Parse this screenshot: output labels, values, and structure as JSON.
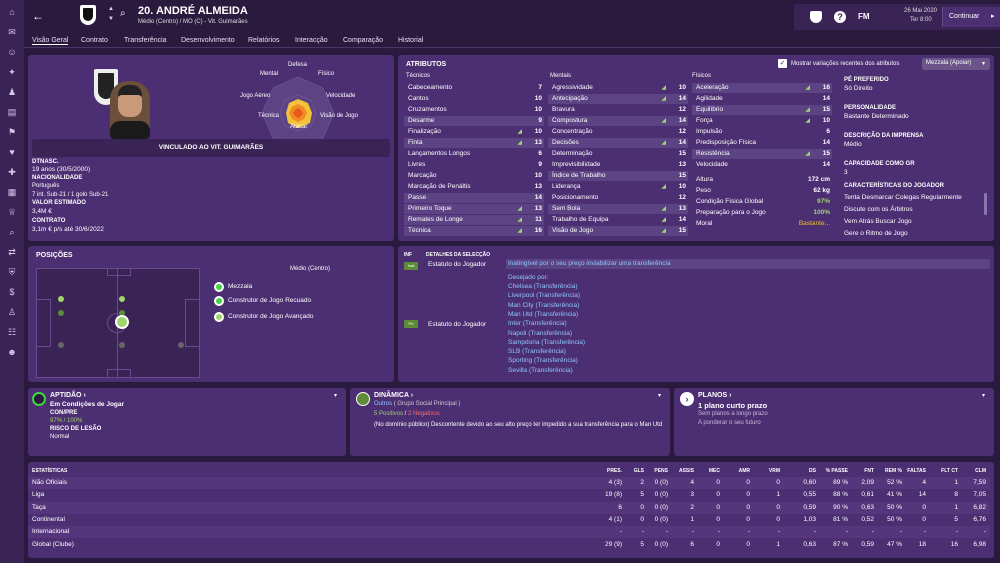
{
  "header": {
    "player_title": "20. ANDRÉ ALMEIDA",
    "subtitle": "Médio (Centro) / MO (C) - Vit. Guimarães",
    "date": "26 Mai 2020",
    "time": "Ter 8:00",
    "continue_label": "Continuar",
    "fm_label": "FM"
  },
  "nav": {
    "tabs": [
      "Visão Geral",
      "Contrato",
      "Transferência",
      "Desenvolvimento",
      "Relatórios",
      "Interacção",
      "Comparação",
      "Historial"
    ]
  },
  "profile": {
    "contract_banner": "VINCULADO AO VIT. GUIMARÃES",
    "radar_labels": {
      "top": "Defesa",
      "left_top": "Mental",
      "right_top": "Físico",
      "left": "Jogo Aéreo",
      "right": "Velocidade",
      "left_bottom": "Técnica",
      "right_bottom": "Visão de Jogo",
      "bottom": "Atacar"
    },
    "dob_label": "DTNASC.",
    "dob_value": "19 anos (30/5/2000)",
    "nationality_label": "NACIONALIDADE",
    "nationality_value": "Português",
    "caps": "7 int. Sub-21 / 1 golo Sub-21",
    "value_label": "VALOR ESTIMADO",
    "value_value": "3,4M €",
    "contract_label": "CONTRATO",
    "contract_value": "3,1m € p/s até 30/6/2022"
  },
  "attributes": {
    "title": "ATRIBUTOS",
    "checkbox_label": "Mostrar variações recentes dos atributos",
    "role_select": "Mezzala (Apoiar)",
    "technical_header": "Técnicos",
    "mental_header": "Mentais",
    "physical_header": "Físicos",
    "technical": [
      {
        "name": "Cabeceamento",
        "value": "7"
      },
      {
        "name": "Cantos",
        "value": "10"
      },
      {
        "name": "Cruzamentos",
        "value": "10"
      },
      {
        "name": "Desarme",
        "value": "9"
      },
      {
        "name": "Finalização",
        "value": "10"
      },
      {
        "name": "Finta",
        "value": "13"
      },
      {
        "name": "Lançamentos Longos",
        "value": "6"
      },
      {
        "name": "Livres",
        "value": "9"
      },
      {
        "name": "Marcação",
        "value": "10"
      },
      {
        "name": "Marcação de Penáltis",
        "value": "13"
      },
      {
        "name": "Passe",
        "value": "14"
      },
      {
        "name": "Primeiro Toque",
        "value": "13"
      },
      {
        "name": "Remates de Longe",
        "value": "11"
      },
      {
        "name": "Técnica",
        "value": "16"
      }
    ],
    "mental": [
      {
        "name": "Agressividade",
        "value": "10"
      },
      {
        "name": "Antecipação",
        "value": "14"
      },
      {
        "name": "Bravura",
        "value": "12"
      },
      {
        "name": "Compostura",
        "value": "14"
      },
      {
        "name": "Concentração",
        "value": "12"
      },
      {
        "name": "Decisões",
        "value": "14"
      },
      {
        "name": "Determinação",
        "value": "15"
      },
      {
        "name": "Imprevisibilidade",
        "value": "13"
      },
      {
        "name": "Índice de Trabalho",
        "value": "15"
      },
      {
        "name": "Liderança",
        "value": "10"
      },
      {
        "name": "Posicionamento",
        "value": "12"
      },
      {
        "name": "Sem Bola",
        "value": "13"
      },
      {
        "name": "Trabalho de Equipa",
        "value": "14"
      },
      {
        "name": "Visão de Jogo",
        "value": "15"
      }
    ],
    "physical": [
      {
        "name": "Aceleração",
        "value": "16"
      },
      {
        "name": "Agilidade",
        "value": "14"
      },
      {
        "name": "Equilíbrio",
        "value": "15"
      },
      {
        "name": "Força",
        "value": "10"
      },
      {
        "name": "Impulsão",
        "value": "6"
      },
      {
        "name": "Predisposição Física",
        "value": "14"
      },
      {
        "name": "Resistência",
        "value": "15"
      },
      {
        "name": "Velocidade",
        "value": "14"
      }
    ],
    "extra": [
      {
        "name": "Altura",
        "value": "172 cm"
      },
      {
        "name": "Peso",
        "value": "62 kg"
      },
      {
        "name": "Condição Física Global",
        "value": "97%"
      },
      {
        "name": "Preparação para o Jogo",
        "value": "100%"
      },
      {
        "name": "Moral",
        "value": "Bastante..."
      }
    ]
  },
  "side_info": {
    "foot_label": "PÉ PREFERIDO",
    "foot_value": "Só Direito",
    "personality_label": "PERSONALIDADE",
    "personality_value": "Bastante Determinado",
    "press_label": "DESCRIÇÃO DA IMPRENSA",
    "press_value": "Médio",
    "gk_label": "CAPACIDADE COMO GR",
    "gk_value": "3",
    "traits_label": "CARACTERÍSTICAS DO JOGADOR",
    "traits": [
      "Tenta Desmarcar Colegas Regularmente",
      "Discute com os Árbitros",
      "Vem Atrás Buscar Jogo",
      "Gere o Ritmo de Jogo"
    ]
  },
  "positions": {
    "title": "POSIÇÕES",
    "position_label": "Médio (Centro)",
    "roles": [
      "Mezzala",
      "Construtor de Jogo Recuado",
      "Construtor de Jogo Avançado"
    ]
  },
  "transfer": {
    "inf_label": "INF",
    "details_label": "DETALHES DA SELECÇÃO",
    "status1_label": "Estatuto do Jogador",
    "status1_text": "Inatingível por o seu preço inviabilizar uma transferência",
    "status2_label": "Estatuto do Jogador",
    "wanted_label": "Desejado por:",
    "wanted_by": [
      "Chelsea (Transferência)",
      "Liverpool (Transferência)",
      "Man City (Transferência)",
      "Man Utd (Transferência)",
      "Inter (Transferência)",
      "Napoli (Transferência)",
      "Sampdoria (Transferência)",
      "SLB (Transferência)",
      "Sporting (Transferência)",
      "Sevilla (Transferência)"
    ]
  },
  "fitness": {
    "title": "APTIDÃO",
    "status": "Em Condições de Jogar",
    "con_label": "CON/PRE",
    "con_value": "97% / 100%",
    "injury_label": "RISCO DE LESÃO",
    "injury_value": "Normal"
  },
  "dynamics": {
    "title": "DINÂMICA",
    "group": "Outros",
    "group_detail": "( Grupo Social Principal )",
    "positive": "5 Positivos",
    "negative": "2 Negativos",
    "text": "(No domínio público) Descontente devido ao seu alto preço ter impedido a sua transferência para o Man Utd"
  },
  "plans": {
    "title": "PLANOS",
    "short_plan": "1 plano curto prazo",
    "long_plan": "Sem planos a longo prazo",
    "future": "A ponderar o seu futuro"
  },
  "stats": {
    "title": "ESTATÍSTICAS",
    "headers": [
      "PRES.",
      "GLS",
      "PENS",
      "ASSIS",
      "MEC",
      "AMR",
      "VRM",
      "DS",
      "% PASSE",
      "FNT",
      "REM %",
      "FALTAS",
      "FLT CT",
      "CLM"
    ],
    "rows": [
      {
        "name": "Não Oficiais",
        "values": [
          "4 (3)",
          "2",
          "0 (0)",
          "4",
          "0",
          "0",
          "0",
          "0,60",
          "89 %",
          "2,09",
          "52 %",
          "4",
          "1",
          "7,59"
        ]
      },
      {
        "name": "Liga",
        "values": [
          "19 (8)",
          "5",
          "0 (0)",
          "3",
          "0",
          "0",
          "1",
          "0,55",
          "88 %",
          "0,61",
          "41 %",
          "14",
          "8",
          "7,05"
        ]
      },
      {
        "name": "Taça",
        "values": [
          "6",
          "0",
          "0 (0)",
          "2",
          "0",
          "0",
          "0",
          "0,59",
          "90 %",
          "0,63",
          "50 %",
          "0",
          "1",
          "6,82"
        ]
      },
      {
        "name": "Continental",
        "values": [
          "4 (1)",
          "0",
          "0 (0)",
          "1",
          "0",
          "0",
          "0",
          "1,03",
          "81 %",
          "0,52",
          "50 %",
          "0",
          "5",
          "6,76"
        ]
      },
      {
        "name": "Internacional",
        "values": [
          "-",
          "-",
          "-",
          "-",
          "-",
          "-",
          "-",
          "-",
          "-",
          "-",
          "-",
          "-",
          "-",
          "-"
        ]
      },
      {
        "name": "Global (Clube)",
        "values": [
          "29 (9)",
          "5",
          "0 (0)",
          "6",
          "0",
          "0",
          "1",
          "0,63",
          "87 %",
          "0,59",
          "47 %",
          "18",
          "16",
          "6,98"
        ]
      }
    ]
  },
  "colors": {
    "accent": "#9fd66b",
    "panel": "#4c2e72",
    "background": "#2a1a3e"
  }
}
